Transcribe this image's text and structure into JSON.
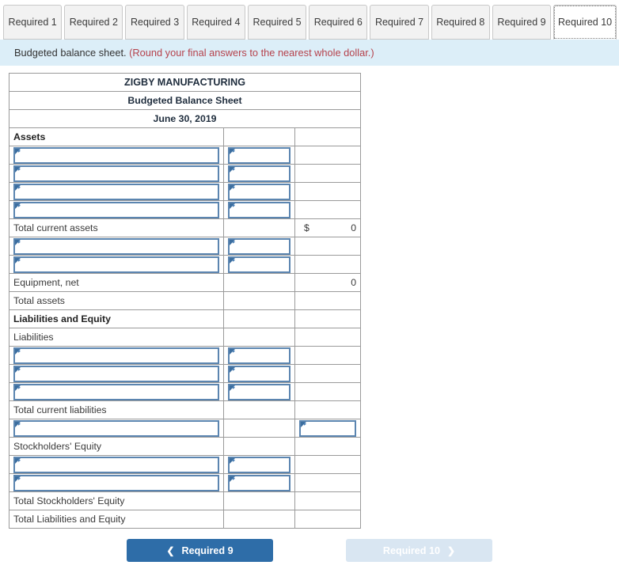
{
  "tabs": [
    {
      "label": "Required 1",
      "active": false
    },
    {
      "label": "Required 2",
      "active": false
    },
    {
      "label": "Required 3",
      "active": false
    },
    {
      "label": "Required 4",
      "active": false
    },
    {
      "label": "Required 5",
      "active": false
    },
    {
      "label": "Required 6",
      "active": false
    },
    {
      "label": "Required 7",
      "active": false
    },
    {
      "label": "Required 8",
      "active": false
    },
    {
      "label": "Required 9",
      "active": false
    },
    {
      "label": "Required 10",
      "active": true
    }
  ],
  "banner": {
    "text": "Budgeted balance sheet.",
    "note": "(Round your final answers to the nearest whole dollar.)",
    "note_color": "#b5424c",
    "background": "#dceef8"
  },
  "sheet": {
    "header_background": "#73a9e0",
    "title": "ZIGBY MANUFACTURING",
    "subtitle": "Budgeted Balance Sheet",
    "date": "June 30, 2019",
    "rows": [
      {
        "label": "Assets",
        "bold": true,
        "c1": "label",
        "c2": "empty",
        "c3": "empty"
      },
      {
        "label": "",
        "c1": "input",
        "c2": "input",
        "c3": "empty"
      },
      {
        "label": "",
        "c1": "input",
        "c2": "input",
        "c3": "empty"
      },
      {
        "label": "",
        "c1": "input",
        "c2": "input",
        "c3": "empty"
      },
      {
        "label": "",
        "c1": "input",
        "c2": "input",
        "c3": "empty"
      },
      {
        "label": "Total current assets",
        "c1": "label",
        "c2": "empty",
        "c3": "value",
        "currency": "$",
        "value": "0"
      },
      {
        "label": "",
        "c1": "input",
        "c2": "input",
        "c3": "empty"
      },
      {
        "label": "",
        "c1": "input",
        "c2": "input",
        "c3": "empty"
      },
      {
        "label": "Equipment, net",
        "c1": "label",
        "c2": "empty",
        "c3": "value",
        "currency": "",
        "value": "0"
      },
      {
        "label": "Total assets",
        "c1": "label",
        "c2": "empty",
        "c3": "total"
      },
      {
        "label": "Liabilities and Equity",
        "bold": true,
        "c1": "label",
        "c2": "empty",
        "c3": "empty"
      },
      {
        "label": "Liabilities",
        "c1": "label",
        "c2": "empty",
        "c3": "empty"
      },
      {
        "label": "",
        "c1": "input",
        "c2": "input",
        "c3": "empty"
      },
      {
        "label": "",
        "c1": "input",
        "c2": "input",
        "c3": "empty"
      },
      {
        "label": "",
        "c1": "input",
        "c2": "input",
        "c3": "empty"
      },
      {
        "label": "Total current liabilities",
        "c1": "label",
        "c2": "empty",
        "c3": "empty"
      },
      {
        "label": "",
        "c1": "input",
        "c2": "empty",
        "c3": "input"
      },
      {
        "label": "Stockholders' Equity",
        "c1": "label",
        "c2": "empty",
        "c3": "empty"
      },
      {
        "label": "",
        "c1": "input",
        "c2": "input",
        "c3": "empty"
      },
      {
        "label": "",
        "c1": "input",
        "c2": "input",
        "c3": "empty"
      },
      {
        "label": "Total Stockholders' Equity",
        "c1": "label",
        "c2": "empty",
        "c3": "empty"
      },
      {
        "label": "Total Liabilities and Equity",
        "c1": "label",
        "c2": "empty",
        "c3": "total"
      }
    ]
  },
  "nav": {
    "prev_label": "Required 9",
    "prev_chevron": "chevron-left-icon",
    "prev_color": "#2e6da8",
    "next_label": "Required 10",
    "next_chevron": "chevron-right-icon",
    "next_color": "#d9e6f2",
    "next_disabled": true
  }
}
